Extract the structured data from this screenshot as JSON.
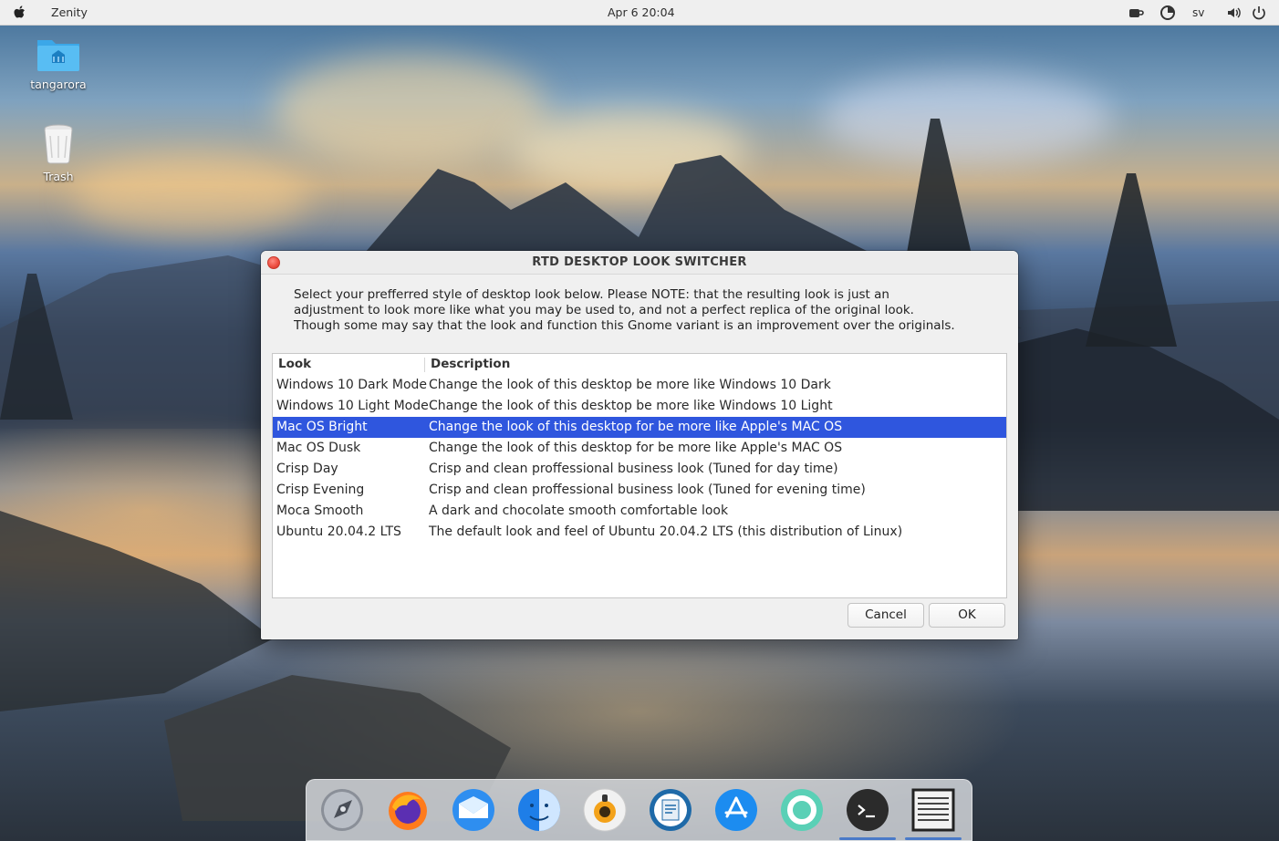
{
  "topbar": {
    "app_name": "Zenity",
    "clock": "Apr 6  20:04",
    "language": "sv"
  },
  "desktop": {
    "icons": [
      {
        "label": "tangarora",
        "icon": "home-folder-icon"
      },
      {
        "label": "Trash",
        "icon": "trash-icon"
      }
    ]
  },
  "dialog": {
    "title": "RTD DESKTOP LOOK SWITCHER",
    "intro": [
      "Select your prefferred style of desktop look below. Please NOTE: that the resulting look is just an",
      "adjustment to look more like what you may be used to, and not a perfect replica of the original look.",
      "Though some may say that the look and function this Gnome variant is an improvement over the originals."
    ],
    "columns": [
      "Look",
      "Description"
    ],
    "rows": [
      {
        "look": "Windows 10 Dark Mode",
        "description": "Change the look of this desktop be more like Windows 10 Dark"
      },
      {
        "look": "Windows 10 Light Mode",
        "description": "Change the look of this desktop be more like Windows 10 Light"
      },
      {
        "look": "Mac OS Bright",
        "description": "Change the look of this desktop for be more like Apple's MAC OS"
      },
      {
        "look": "Mac OS Dusk",
        "description": "Change the look of this desktop for be more like Apple's MAC OS"
      },
      {
        "look": "Crisp Day",
        "description": "Crisp and clean proffessional business look (Tuned for day time)"
      },
      {
        "look": "Crisp Evening",
        "description": "Crisp and clean proffessional business look (Tuned for evening time)"
      },
      {
        "look": "Moca Smooth",
        "description": "A dark and chocolate smooth comfortable look"
      },
      {
        "look": "Ubuntu 20.04.2 LTS",
        "description": "The default look and feel of Ubuntu 20.04.2 LTS (this distribution of Linux)"
      }
    ],
    "selected_look": "Mac OS Bright",
    "buttons": {
      "cancel": "Cancel",
      "ok": "OK"
    }
  },
  "dock": {
    "items": [
      "launchpad-icon",
      "firefox-icon",
      "mail-icon",
      "finder-icon",
      "rhythmbox-icon",
      "document-viewer-icon",
      "app-store-icon",
      "help-lifebuoy-icon",
      "terminal-icon",
      "zenity-window-icon"
    ],
    "running": [
      "terminal-icon",
      "zenity-window-icon"
    ]
  },
  "colors": {
    "selection": "#2f56de",
    "close_button": "#ec4b3e"
  }
}
